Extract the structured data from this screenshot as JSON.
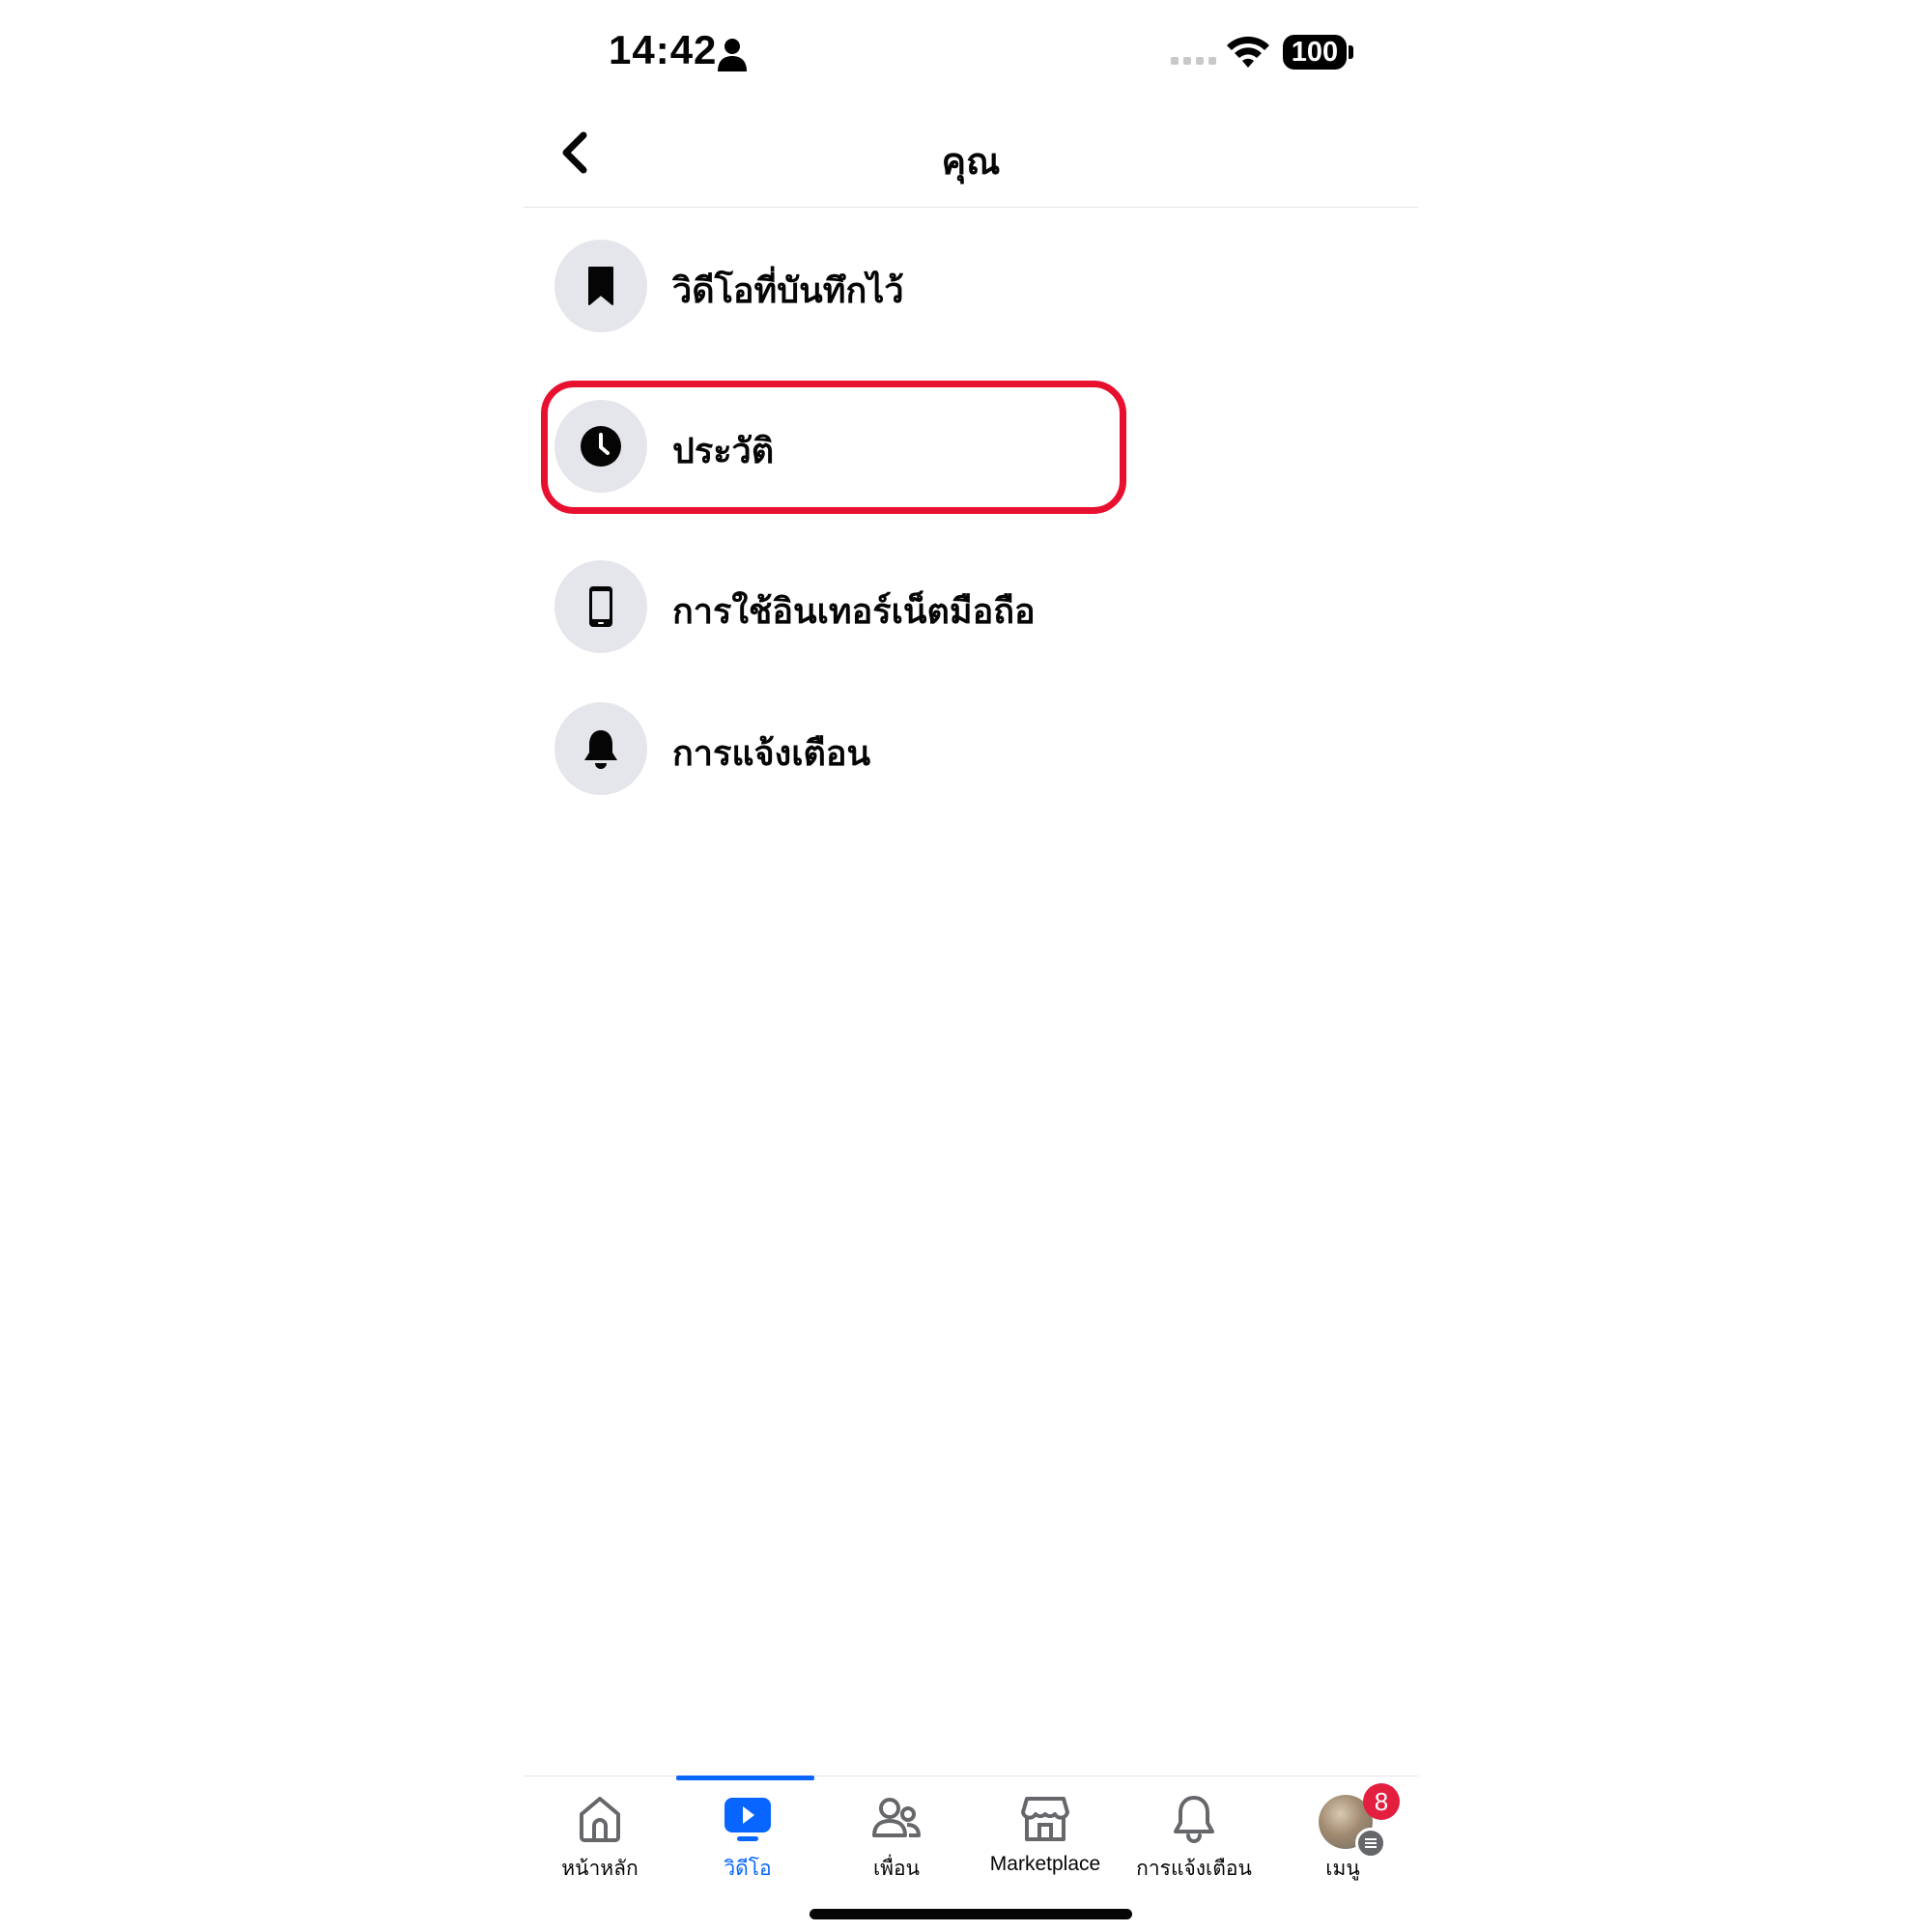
{
  "status_bar": {
    "time": "14:42",
    "battery": "100"
  },
  "header": {
    "title": "คุณ",
    "back_icon": "chevron-left-icon"
  },
  "menu": [
    {
      "label": "วิดีโอที่บันทึกไว้",
      "icon": "bookmark-icon"
    },
    {
      "label": "ประวัติ",
      "icon": "clock-icon",
      "highlighted": true
    },
    {
      "label": "การใช้อินเทอร์เน็ตมือถือ",
      "icon": "mobile-phone-icon"
    },
    {
      "label": "การแจ้งเตือน",
      "icon": "bell-icon"
    }
  ],
  "tabbar": {
    "active": "video",
    "items": [
      {
        "label": "หน้าหลัก",
        "icon": "home-icon"
      },
      {
        "label": "วิดีโอ",
        "icon": "video-play-icon"
      },
      {
        "label": "เพื่อน",
        "icon": "friends-icon"
      },
      {
        "label": "Marketplace",
        "icon": "marketplace-shop-icon"
      },
      {
        "label": "การแจ้งเตือน",
        "icon": "notifications-bell-icon"
      },
      {
        "label": "เมนู",
        "icon": "profile-avatar"
      }
    ],
    "menu_badge": "8"
  },
  "colors": {
    "accent": "#0866ff",
    "highlight": "#e8102f",
    "badge": "#e41e3f",
    "icon_circle": "#e4e6eb"
  }
}
